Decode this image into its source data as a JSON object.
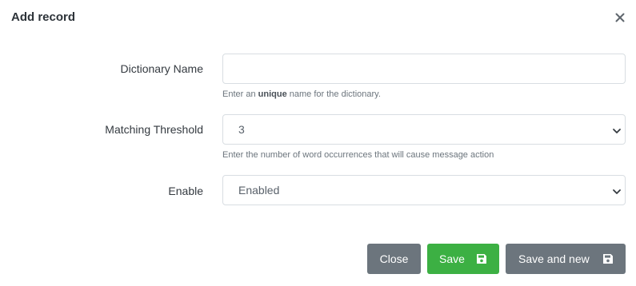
{
  "modal": {
    "title": "Add record"
  },
  "form": {
    "dictionary_name": {
      "label": "Dictionary Name",
      "value": "",
      "placeholder": "",
      "help_prefix": "Enter an ",
      "help_bold": "unique",
      "help_suffix": " name for the dictionary."
    },
    "matching_threshold": {
      "label": "Matching Threshold",
      "value": "3",
      "help": "Enter the number of word occurrences that will cause message action"
    },
    "enable": {
      "label": "Enable",
      "value": "Enabled"
    }
  },
  "buttons": {
    "close": "Close",
    "save": "Save",
    "save_and_new": "Save and new"
  },
  "icons": {
    "close": "close-icon",
    "select": "chevron-down-icon",
    "save": "floppy-disk-icon"
  },
  "colors": {
    "save_button": "#3cb043",
    "secondary_button": "#6c757d"
  }
}
